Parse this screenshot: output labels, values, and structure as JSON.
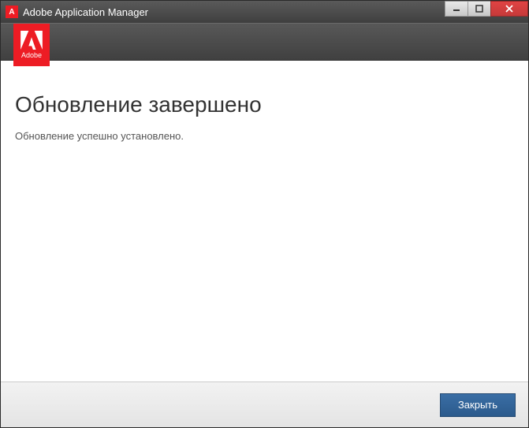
{
  "titlebar": {
    "title": "Adobe Application Manager",
    "icon_letter": "A"
  },
  "logo": {
    "brand_text": "Adobe"
  },
  "content": {
    "heading": "Обновление завершено",
    "message": "Обновление успешно установлено."
  },
  "footer": {
    "close_label": "Закрыть"
  }
}
